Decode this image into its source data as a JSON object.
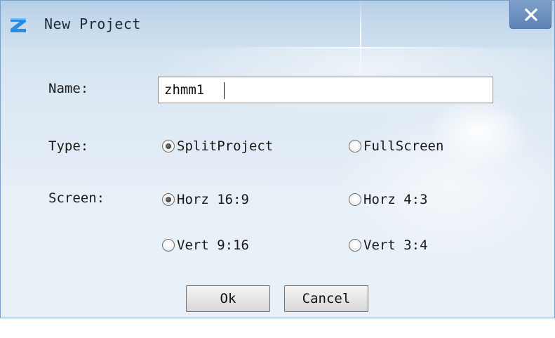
{
  "window": {
    "title": "New Project",
    "close_icon": "close-x-icon",
    "logo_icon": "z-logo-icon",
    "colors": {
      "titlebar": "#c5d9ec",
      "close_button": "#6a8fc0",
      "body": "#e4edf6"
    }
  },
  "form": {
    "name_label": "Name:",
    "name_value": "zhmm1",
    "type_label": "Type:",
    "type_options": [
      {
        "label": "SplitProject",
        "checked": true
      },
      {
        "label": "FullScreen",
        "checked": false
      }
    ],
    "screen_label": "Screen:",
    "screen_options": [
      {
        "label": "Horz 16:9",
        "checked": true
      },
      {
        "label": "Horz 4:3",
        "checked": false
      },
      {
        "label": "Vert 9:16",
        "checked": false
      },
      {
        "label": "Vert 3:4",
        "checked": false
      }
    ]
  },
  "buttons": {
    "ok_label": "Ok",
    "cancel_label": "Cancel"
  }
}
